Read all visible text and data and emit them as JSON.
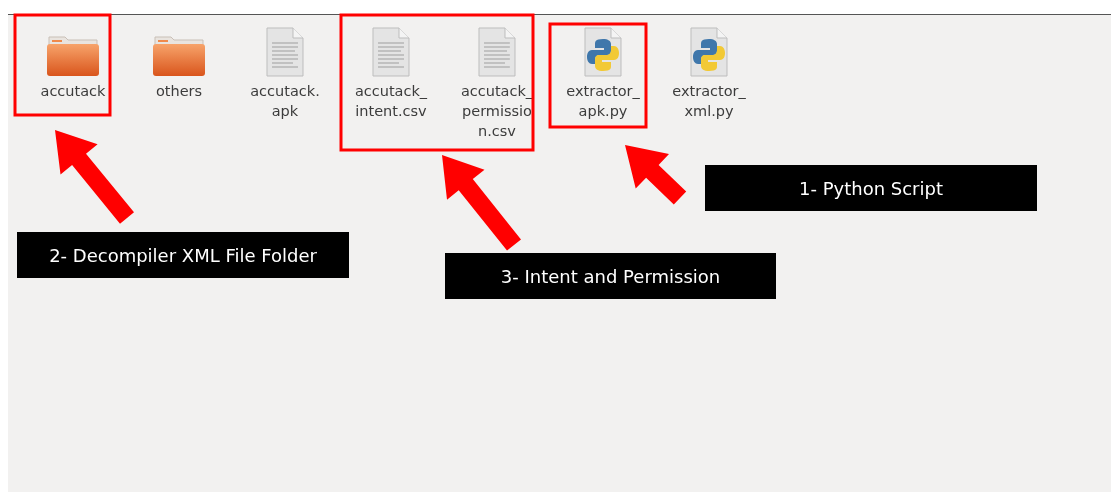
{
  "files": [
    {
      "name": "accutack",
      "kind": "folder"
    },
    {
      "name": "others",
      "kind": "folder"
    },
    {
      "name": "accutack.\napk",
      "kind": "text"
    },
    {
      "name": "accutack_\nintent.csv",
      "kind": "text"
    },
    {
      "name": "accutack_\npermissio\nn.csv",
      "kind": "text"
    },
    {
      "name": "extractor_\napk.py",
      "kind": "python"
    },
    {
      "name": "extractor_\nxml.py",
      "kind": "python"
    }
  ],
  "callouts": [
    {
      "text": "1- Python Script"
    },
    {
      "text": "2- Decompiler XML File Folder"
    },
    {
      "text": "3- Intent and Permission"
    }
  ]
}
